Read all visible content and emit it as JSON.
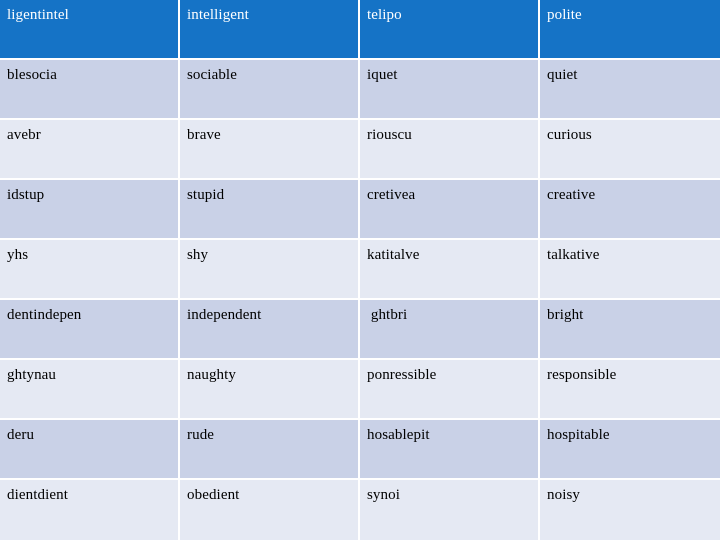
{
  "table": {
    "columns": 4,
    "header": {
      "background_color": "#1573c6",
      "text_color": "#ffffff",
      "cells": [
        "ligentintel",
        "intelligent",
        "telipo",
        "polite"
      ]
    },
    "row_colors": {
      "dark": "#c9d1e7",
      "light": "#e5e9f3",
      "gridline": "#ffffff"
    },
    "rows": [
      {
        "shade": "dark",
        "cells": [
          "blesocia",
          "sociable",
          "iquet",
          "quiet"
        ]
      },
      {
        "shade": "light",
        "cells": [
          "avebr",
          "brave",
          "riouscu",
          "curious"
        ]
      },
      {
        "shade": "dark",
        "cells": [
          "idstup",
          "stupid",
          "cretivea",
          "creative"
        ]
      },
      {
        "shade": "light",
        "cells": [
          "yhs",
          "shy",
          "katitalve",
          "talkative"
        ]
      },
      {
        "shade": "dark",
        "cells": [
          "dentindepen",
          "independent",
          " ghtbri",
          "bright"
        ]
      },
      {
        "shade": "light",
        "cells": [
          "ghtynau",
          "naughty",
          "ponressible",
          "responsible"
        ]
      },
      {
        "shade": "dark",
        "cells": [
          "deru",
          "rude",
          "hosablepit",
          "hospitable"
        ]
      },
      {
        "shade": "light",
        "cells": [
          "dientdient",
          "obedient",
          "synoi",
          "noisy"
        ]
      }
    ]
  }
}
